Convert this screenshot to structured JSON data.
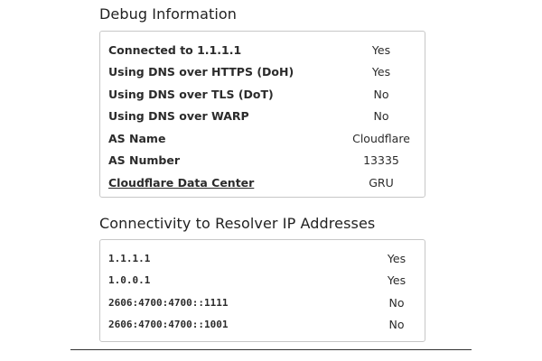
{
  "debug": {
    "title": "Debug Information",
    "rows": [
      {
        "label": "Connected to 1.1.1.1",
        "value": "Yes"
      },
      {
        "label": "Using DNS over HTTPS (DoH)",
        "value": "Yes"
      },
      {
        "label": "Using DNS over TLS (DoT)",
        "value": "No"
      },
      {
        "label": "Using DNS over WARP",
        "value": "No"
      },
      {
        "label": "AS Name",
        "value": "Cloudflare"
      },
      {
        "label": "AS Number",
        "value": "13335"
      },
      {
        "label": "Cloudflare Data Center",
        "value": "GRU"
      }
    ]
  },
  "connectivity": {
    "title": "Connectivity to Resolver IP Addresses",
    "rows": [
      {
        "label": "1.1.1.1",
        "value": "Yes"
      },
      {
        "label": "1.0.0.1",
        "value": "Yes"
      },
      {
        "label": "2606:4700:4700::1111",
        "value": "No"
      },
      {
        "label": "2606:4700:4700::1001",
        "value": "No"
      }
    ]
  },
  "colors": {
    "link": "#1f6fd6",
    "border": "#c7c7c7",
    "text": "#222222"
  }
}
